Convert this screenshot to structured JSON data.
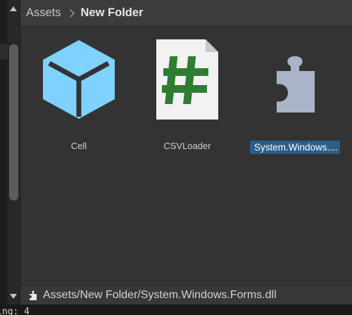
{
  "breadcrumb": {
    "root": "Assets",
    "current": "New Folder"
  },
  "assets": [
    {
      "name": "Cell",
      "icon": "prefab-cube-icon",
      "selected": false
    },
    {
      "name": "CSVLoader",
      "icon": "csharp-script-icon",
      "selected": false
    },
    {
      "name": "System.Windows....",
      "icon": "assembly-puzzle-icon",
      "selected": true
    }
  ],
  "path_bar": {
    "path": "Assets/New Folder/System.Windows.Forms.dll",
    "icon": "assembly-small-icon"
  },
  "console": {
    "text": "ing: 4"
  },
  "colors": {
    "prefab_blue": "#7fd1ff",
    "script_green": "#2e7d32",
    "selection_blue": "#2c5d87",
    "puzzle_gray": "#aab4c8"
  }
}
